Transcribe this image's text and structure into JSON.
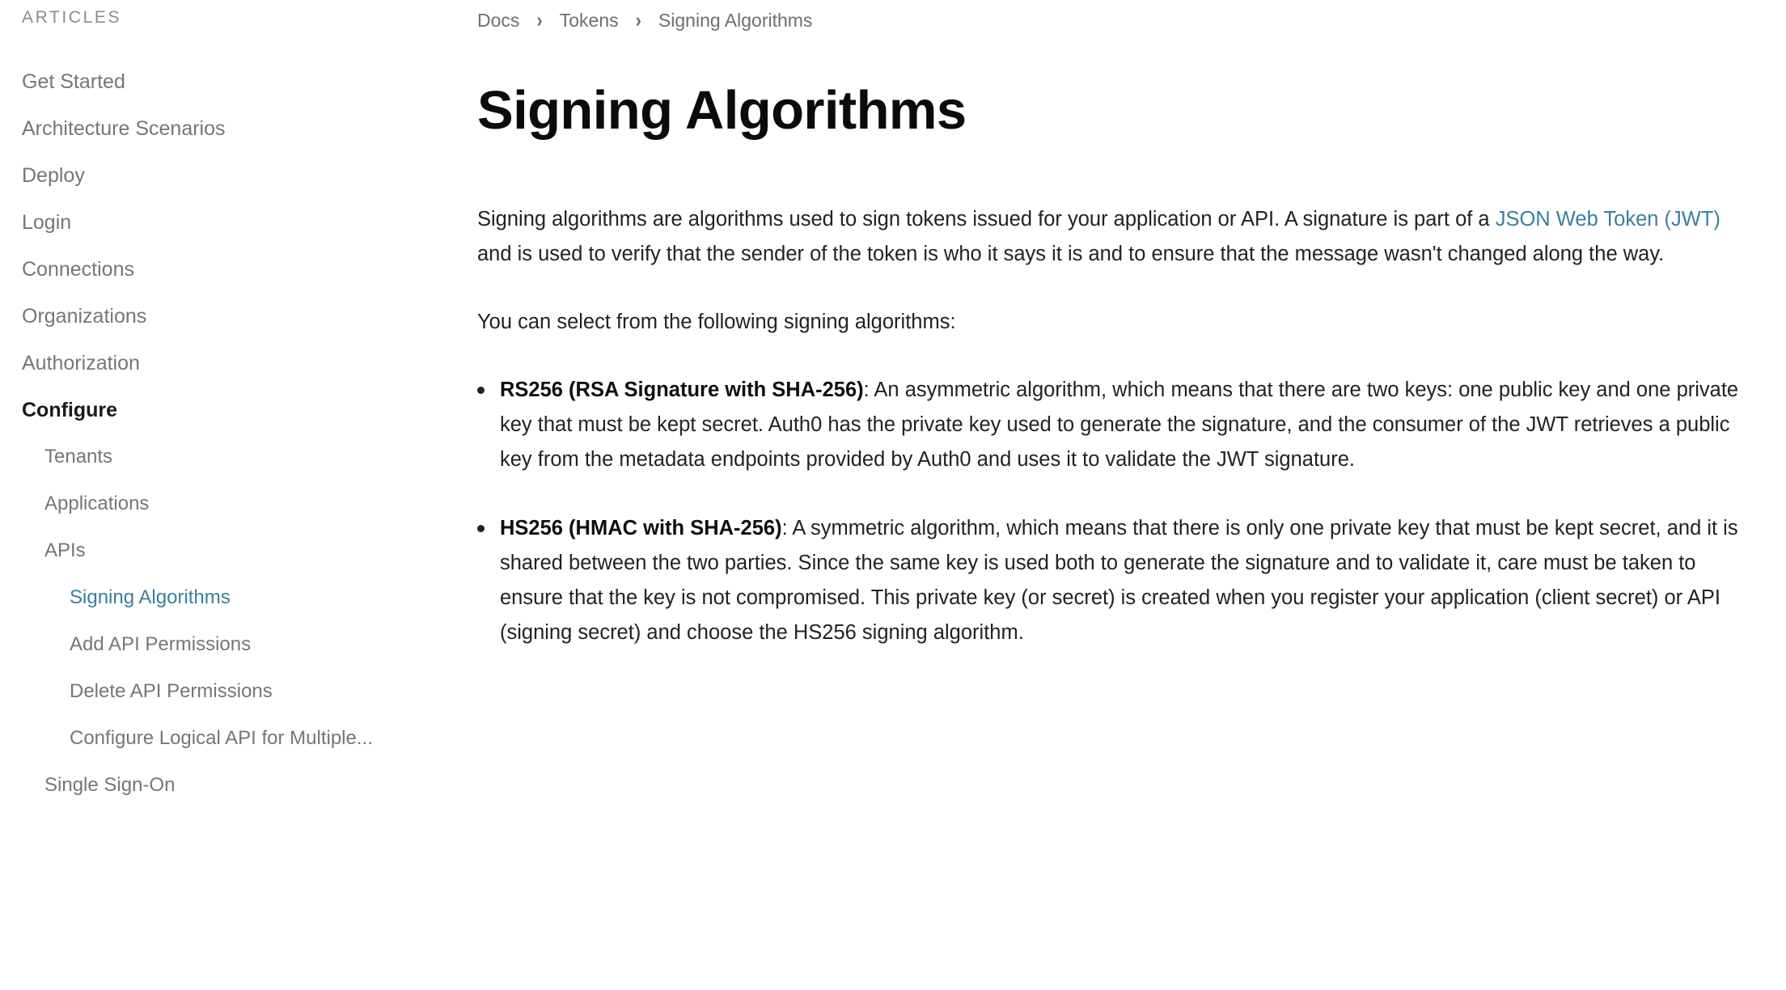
{
  "sidebar": {
    "heading": "ARTICLES",
    "items": [
      {
        "label": "Get Started",
        "level": 1,
        "state": "default"
      },
      {
        "label": "Architecture Scenarios",
        "level": 1,
        "state": "default"
      },
      {
        "label": "Deploy",
        "level": 1,
        "state": "default"
      },
      {
        "label": "Login",
        "level": 1,
        "state": "default"
      },
      {
        "label": "Connections",
        "level": 1,
        "state": "default"
      },
      {
        "label": "Organizations",
        "level": 1,
        "state": "default"
      },
      {
        "label": "Authorization",
        "level": 1,
        "state": "default"
      },
      {
        "label": "Configure",
        "level": 1,
        "state": "section"
      },
      {
        "label": "Tenants",
        "level": 2,
        "state": "default"
      },
      {
        "label": "Applications",
        "level": 2,
        "state": "default"
      },
      {
        "label": "APIs",
        "level": 2,
        "state": "default"
      },
      {
        "label": "Signing Algorithms",
        "level": 3,
        "state": "active"
      },
      {
        "label": "Add API Permissions",
        "level": 3,
        "state": "default"
      },
      {
        "label": "Delete API Permissions",
        "level": 3,
        "state": "default"
      },
      {
        "label": "Configure Logical API for Multiple...",
        "level": 3,
        "state": "default"
      },
      {
        "label": "Single Sign-On",
        "level": 2,
        "state": "default"
      }
    ]
  },
  "breadcrumb": {
    "separator": "›",
    "items": [
      {
        "label": "Docs"
      },
      {
        "label": "Tokens"
      },
      {
        "label": "Signing Algorithms"
      }
    ]
  },
  "main": {
    "title": "Signing Algorithms",
    "intro": {
      "before_link": "Signing algorithms are algorithms used to sign tokens issued for your application or API. A signature is part of a ",
      "link_text": "JSON Web Token (JWT)",
      "after_link": " and is used to verify that the sender of the token is who it says it is and to ensure that the message wasn't changed along the way."
    },
    "select_prompt": "You can select from the following signing algorithms:",
    "algorithms": [
      {
        "term": "RS256 (RSA Signature with SHA-256)",
        "description": ": An asymmetric algorithm, which means that there are two keys: one public key and one private key that must be kept secret. Auth0 has the private key used to generate the signature, and the consumer of the JWT retrieves a public key from the metadata endpoints provided by Auth0 and uses it to validate the JWT signature."
      },
      {
        "term": "HS256 (HMAC with SHA-256)",
        "description": ": A symmetric algorithm, which means that there is only one private key that must be kept secret, and it is shared between the two parties. Since the same key is used both to generate the signature and to validate it, care must be taken to ensure that the key is not compromised. This private key (or secret) is created when you register your application (client secret) or API (signing secret) and choose the HS256 signing algorithm."
      }
    ]
  },
  "colors": {
    "link": "#3b7f9e",
    "body_text": "#222226",
    "muted_text": "#76767a",
    "heading_text": "#0b0b0d",
    "background": "#ffffff"
  }
}
